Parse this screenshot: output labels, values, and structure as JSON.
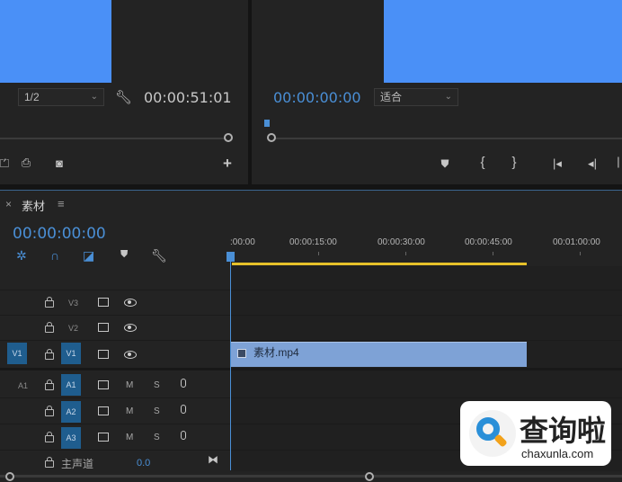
{
  "source_monitor": {
    "scale_dropdown": "1/2",
    "timecode": "00:00:51:01"
  },
  "program_monitor": {
    "timecode": "00:00:00:00",
    "fit_dropdown": "适合"
  },
  "timeline_panel": {
    "close": "×",
    "title": "素材",
    "menu_icon": "≡",
    "playhead_timecode": "00:00:00:00",
    "ruler": [
      ":00:00",
      "00:00:15:00",
      "00:00:30:00",
      "00:00:45:00",
      "00:01:00:00"
    ],
    "tracks": {
      "v3": "V3",
      "v2": "V2",
      "v1_source": "V1",
      "v1": "V1",
      "a1_source": "A1",
      "a1": "A1",
      "a2": "A2",
      "a3": "A3",
      "m": "M",
      "s": "S",
      "master_label": "主声道",
      "master_value": "0.0"
    },
    "clip_name": "素材.mp4",
    "colors": {
      "accent_blue": "#4a8fd6",
      "clip": "#7ea2d6",
      "work_area": "#e6c12a",
      "frame_fill": "#4a90f7"
    }
  },
  "watermark": {
    "brand_cn": "查询啦",
    "brand_en": "chaxunla.com"
  }
}
